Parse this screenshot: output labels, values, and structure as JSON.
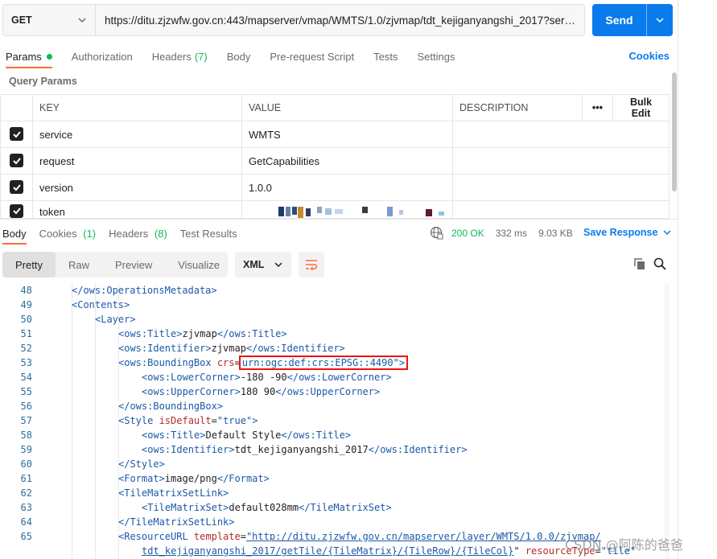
{
  "request": {
    "method": "GET",
    "url": "https://ditu.zjzwfw.gov.cn:443/mapserver/vmap/WMTS/1.0/zjvmap/tdt_kejiganyangshi_2017?service=...",
    "send_label": "Send"
  },
  "request_tabs": [
    {
      "label": "Params",
      "active": true,
      "dot": true
    },
    {
      "label": "Authorization"
    },
    {
      "label": "Headers",
      "count": "(7)"
    },
    {
      "label": "Body"
    },
    {
      "label": "Pre-request Script"
    },
    {
      "label": "Tests"
    },
    {
      "label": "Settings"
    }
  ],
  "cookies_label": "Cookies",
  "query_params_label": "Query Params",
  "params_table": {
    "headers": [
      "KEY",
      "VALUE",
      "DESCRIPTION"
    ],
    "bulk_edit_label": "Bulk Edit",
    "rows": [
      {
        "key": "service",
        "value": "WMTS",
        "checked": true
      },
      {
        "key": "request",
        "value": "GetCapabilities",
        "checked": true
      },
      {
        "key": "version",
        "value": "1.0.0",
        "checked": true
      },
      {
        "key": "token",
        "value": "",
        "checked": true
      }
    ]
  },
  "response_tabs": [
    {
      "label": "Body",
      "active": true
    },
    {
      "label": "Cookies",
      "count": "(1)"
    },
    {
      "label": "Headers",
      "count": "(8)"
    },
    {
      "label": "Test Results"
    }
  ],
  "status": {
    "code": "200 OK",
    "time": "332 ms",
    "size": "9.03 KB"
  },
  "save_response_label": "Save Response",
  "view_modes": [
    "Pretty",
    "Raw",
    "Preview",
    "Visualize"
  ],
  "active_view": "Pretty",
  "format": "XML",
  "code_lines": [
    {
      "n": "48",
      "indent": 1,
      "parts": [
        [
          "tag",
          "</ows:OperationsMetadata>"
        ]
      ]
    },
    {
      "n": "49",
      "indent": 1,
      "parts": [
        [
          "tag",
          "<Contents>"
        ]
      ]
    },
    {
      "n": "50",
      "indent": 2,
      "parts": [
        [
          "tag",
          "<Layer>"
        ]
      ]
    },
    {
      "n": "51",
      "indent": 3,
      "parts": [
        [
          "tag",
          "<ows:Title>"
        ],
        [
          "txt",
          "zjvmap"
        ],
        [
          "tag",
          "</ows:Title>"
        ]
      ]
    },
    {
      "n": "52",
      "indent": 3,
      "parts": [
        [
          "tag",
          "<ows:Identifier>"
        ],
        [
          "txt",
          "zjvmap"
        ],
        [
          "tag",
          "</ows:Identifier>"
        ]
      ]
    },
    {
      "n": "53",
      "indent": 3,
      "parts": [
        [
          "tag",
          "<ows:BoundingBox "
        ],
        [
          "attr",
          "crs"
        ],
        [
          "txt",
          "="
        ],
        [
          "hl",
          "urn:ogc:def:crs:EPSG::4490\">"
        ]
      ]
    },
    {
      "n": "54",
      "indent": 4,
      "parts": [
        [
          "tag",
          "<ows:LowerCorner>"
        ],
        [
          "txt",
          "-180 -90"
        ],
        [
          "tag",
          "</ows:LowerCorner>"
        ]
      ]
    },
    {
      "n": "55",
      "indent": 4,
      "parts": [
        [
          "tag",
          "<ows:UpperCorner>"
        ],
        [
          "txt",
          "180 90"
        ],
        [
          "tag",
          "</ows:UpperCorner>"
        ]
      ]
    },
    {
      "n": "56",
      "indent": 3,
      "parts": [
        [
          "tag",
          "</ows:BoundingBox>"
        ]
      ]
    },
    {
      "n": "57",
      "indent": 3,
      "parts": [
        [
          "tag",
          "<Style "
        ],
        [
          "attr",
          "isDefault"
        ],
        [
          "txt",
          "="
        ],
        [
          "aval",
          "\"true\""
        ],
        [
          "tag",
          ">"
        ]
      ]
    },
    {
      "n": "58",
      "indent": 4,
      "parts": [
        [
          "tag",
          "<ows:Title>"
        ],
        [
          "txt",
          "Default Style"
        ],
        [
          "tag",
          "</ows:Title>"
        ]
      ]
    },
    {
      "n": "59",
      "indent": 4,
      "parts": [
        [
          "tag",
          "<ows:Identifier>"
        ],
        [
          "txt",
          "tdt_kejiganyangshi_2017"
        ],
        [
          "tag",
          "</ows:Identifier>"
        ]
      ]
    },
    {
      "n": "60",
      "indent": 3,
      "parts": [
        [
          "tag",
          "</Style>"
        ]
      ]
    },
    {
      "n": "61",
      "indent": 3,
      "parts": [
        [
          "tag",
          "<Format>"
        ],
        [
          "txt",
          "image/png"
        ],
        [
          "tag",
          "</Format>"
        ]
      ]
    },
    {
      "n": "62",
      "indent": 3,
      "parts": [
        [
          "tag",
          "<TileMatrixSetLink>"
        ]
      ]
    },
    {
      "n": "63",
      "indent": 4,
      "parts": [
        [
          "tag",
          "<TileMatrixSet>"
        ],
        [
          "txt",
          "default028mm"
        ],
        [
          "tag",
          "</TileMatrixSet>"
        ]
      ]
    },
    {
      "n": "64",
      "indent": 3,
      "parts": [
        [
          "tag",
          "</TileMatrixSetLink>"
        ]
      ]
    },
    {
      "n": "65",
      "indent": 3,
      "parts": [
        [
          "tag",
          "<ResourceURL "
        ],
        [
          "attr",
          "template"
        ],
        [
          "txt",
          "="
        ],
        [
          "link",
          "\"http://ditu.zjzwfw.gov.cn/mapserver/layer/WMTS/1.0.0/zjvmap/"
        ]
      ]
    },
    {
      "n": "",
      "indent": 4,
      "parts": [
        [
          "link",
          "tdt_kejiganyangshi_2017/getTile/{TileMatrix}/{TileRow}/{TileCol}"
        ],
        [
          "txt",
          "\" "
        ],
        [
          "attr",
          "resourceType"
        ],
        [
          "txt",
          "="
        ],
        [
          "aval",
          "\"tile\""
        ]
      ]
    }
  ],
  "watermark": "CSDN @阿陈的爸爸",
  "colors": {
    "accent_orange": "#ff6c37",
    "send_blue": "#097bed",
    "status_green": "#0cbb52",
    "highlight_red": "#ee1111"
  }
}
